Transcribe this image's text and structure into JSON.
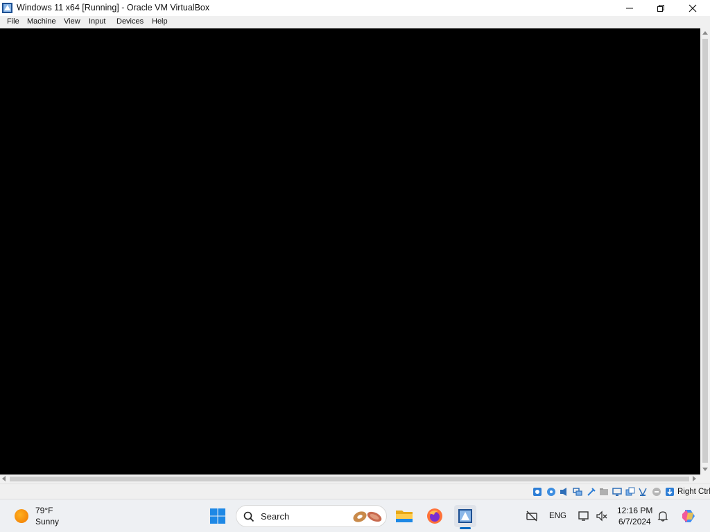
{
  "window": {
    "title": "Windows 11 x64 [Running] - Oracle VM VirtualBox",
    "controls": {
      "minimize": "minimize-icon",
      "maximize": "restore-icon",
      "close": "close-icon"
    }
  },
  "menu": {
    "items": [
      {
        "label": "File"
      },
      {
        "label": "Machine"
      },
      {
        "label": "View"
      },
      {
        "label": "Input"
      },
      {
        "label": "Devices"
      },
      {
        "label": "Help"
      }
    ]
  },
  "statusbar": {
    "icons": [
      "hard-disk-icon",
      "optical-drive-icon",
      "audio-icon",
      "network-icon",
      "usb-icon",
      "shared-folders-icon",
      "display-icon",
      "recording-icon",
      "cpu-icon",
      "mouse-integration-icon",
      "keyboard-icon"
    ],
    "host_key": "Right Ctrl"
  },
  "taskbar": {
    "weather": {
      "temp": "79°F",
      "condition": "Sunny"
    },
    "search": {
      "label": "Search"
    },
    "apps": [
      "file-explorer-icon",
      "firefox-icon",
      "virtualbox-icon"
    ],
    "tray": {
      "lang": "ENG",
      "time": "12:16 PM",
      "date": "6/7/2024"
    }
  },
  "colors": {
    "vm_background": "#000000",
    "taskbar": "#eef0f3",
    "accent": "#0067c0"
  }
}
